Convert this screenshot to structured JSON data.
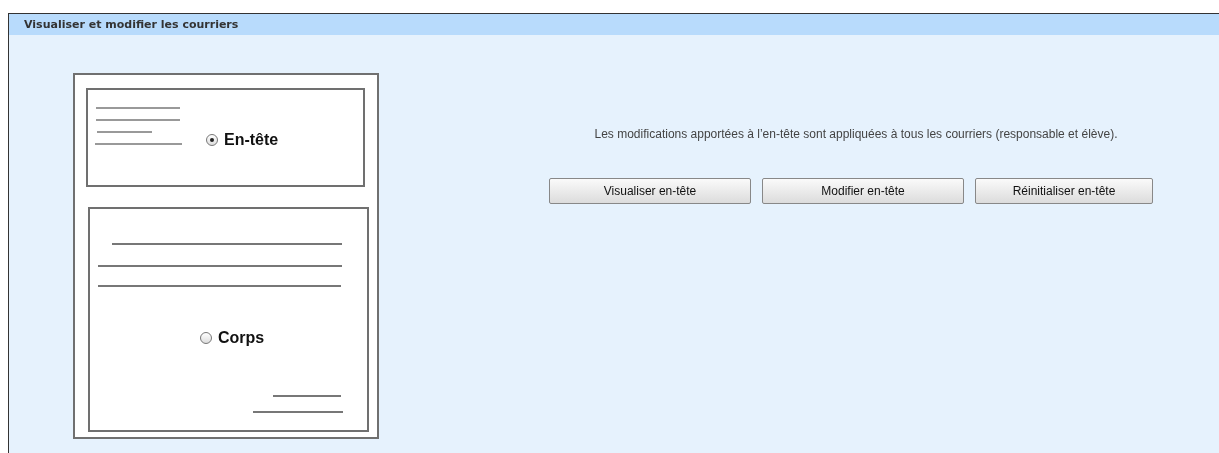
{
  "panel": {
    "title": "Visualiser et modifier les courriers"
  },
  "sections": [
    {
      "label": "En-tête",
      "selected": true
    },
    {
      "label": "Corps",
      "selected": false
    }
  ],
  "message": "Les modifications apportées à l’en-tête sont appliquées à tous les courriers (responsable et élève).",
  "buttons": [
    "Visualiser en-tête",
    "Modifier en-tête",
    "Réinitialiser en-tête"
  ]
}
